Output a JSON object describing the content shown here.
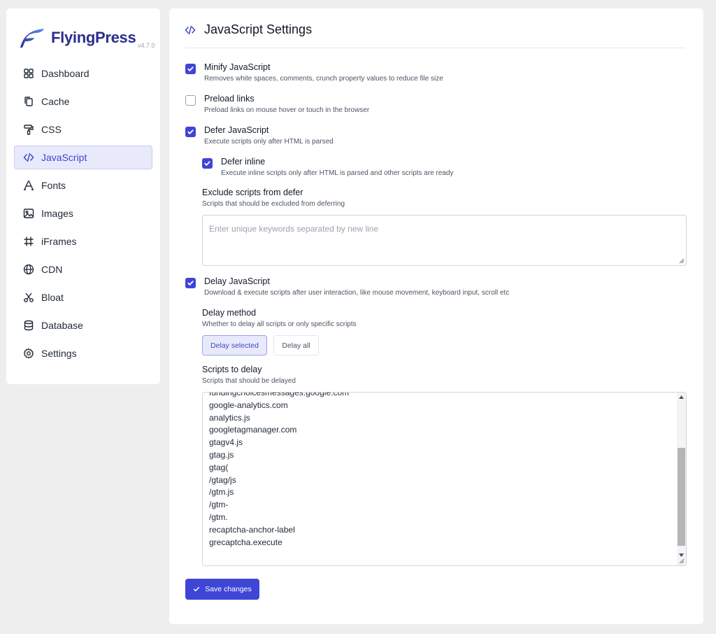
{
  "app": {
    "name": "FlyingPress",
    "version": "v4.7.0"
  },
  "sidebar": {
    "items": [
      {
        "label": "Dashboard",
        "icon": "dashboard-icon"
      },
      {
        "label": "Cache",
        "icon": "copy-icon"
      },
      {
        "label": "CSS",
        "icon": "paint-roller-icon"
      },
      {
        "label": "JavaScript",
        "icon": "code-icon",
        "active": true
      },
      {
        "label": "Fonts",
        "icon": "font-icon"
      },
      {
        "label": "Images",
        "icon": "image-icon"
      },
      {
        "label": "iFrames",
        "icon": "hash-frame-icon"
      },
      {
        "label": "CDN",
        "icon": "globe-icon"
      },
      {
        "label": "Bloat",
        "icon": "scissors-icon"
      },
      {
        "label": "Database",
        "icon": "database-icon"
      },
      {
        "label": "Settings",
        "icon": "gear-icon"
      }
    ]
  },
  "page": {
    "title": "JavaScript Settings"
  },
  "options": {
    "minify": {
      "title": "Minify JavaScript",
      "desc": "Removes white spaces, comments, crunch property values to reduce file size",
      "checked": true
    },
    "preload": {
      "title": "Preload links",
      "desc": "Preload links on mouse hover or touch in the browser",
      "checked": false
    },
    "defer": {
      "title": "Defer JavaScript",
      "desc": "Execute scripts only after HTML is parsed",
      "checked": true
    },
    "defer_inline": {
      "title": "Defer inline",
      "desc": "Execute inline scripts only after HTML is parsed and other scripts are ready",
      "checked": true
    },
    "exclude": {
      "title": "Exclude scripts from defer",
      "desc": "Scripts that should be excluded from deferring",
      "placeholder": "Enter unique keywords separated by new line"
    },
    "delay": {
      "title": "Delay JavaScript",
      "desc": "Download & execute scripts after user interaction, like mouse movement, keyboard input, scroll etc",
      "checked": true
    },
    "delay_method": {
      "title": "Delay method",
      "desc": "Whether to delay all scripts or only specific scripts",
      "selected_label": "Delay selected",
      "all_label": "Delay all"
    },
    "scripts_to_delay": {
      "title": "Scripts to delay",
      "desc": "Scripts that should be delayed",
      "lines": [
        "fundingchoicesmessages.google.com",
        "google-analytics.com",
        "analytics.js",
        "googletagmanager.com",
        "gtagv4.js",
        "gtag.js",
        "gtag(",
        "/gtag/js",
        "/gtm.js",
        "/gtm-",
        "/gtm.",
        "recaptcha-anchor-label",
        "grecaptcha.execute"
      ]
    }
  },
  "save_label": "Save changes",
  "colors": {
    "accent": "#3f46d6",
    "active_bg": "#e8eafb",
    "brand": "#2b2d8f"
  }
}
